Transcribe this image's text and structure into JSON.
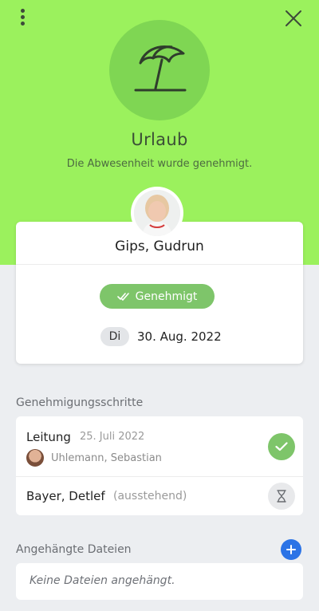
{
  "header": {
    "absence_type": "Urlaub",
    "subtitle": "Die Abwesenheit wurde genehmigt.",
    "type_icon": "beach-umbrella-icon",
    "color_background": "#9bf15d",
    "color_circle": "#7fd653"
  },
  "request": {
    "person_name": "Gips, Gudrun",
    "status_label": "Genehmigt",
    "status_color": "#7ec56a",
    "weekday": "Di",
    "date": "30. Aug. 2022"
  },
  "steps": {
    "section_title": "Genehmigungsschritte",
    "items": [
      {
        "role": "Leitung",
        "date": "25. Juli 2022",
        "person": "Uhlemann, Sebastian",
        "state_icon": "check-icon"
      },
      {
        "person": "Bayer, Detlef",
        "status": "(ausstehend)",
        "state_icon": "hourglass-icon"
      }
    ]
  },
  "files": {
    "section_title": "Angehängte Dateien",
    "empty_text": "Keine Dateien angehängt.",
    "accent_color": "#2b73e6"
  }
}
